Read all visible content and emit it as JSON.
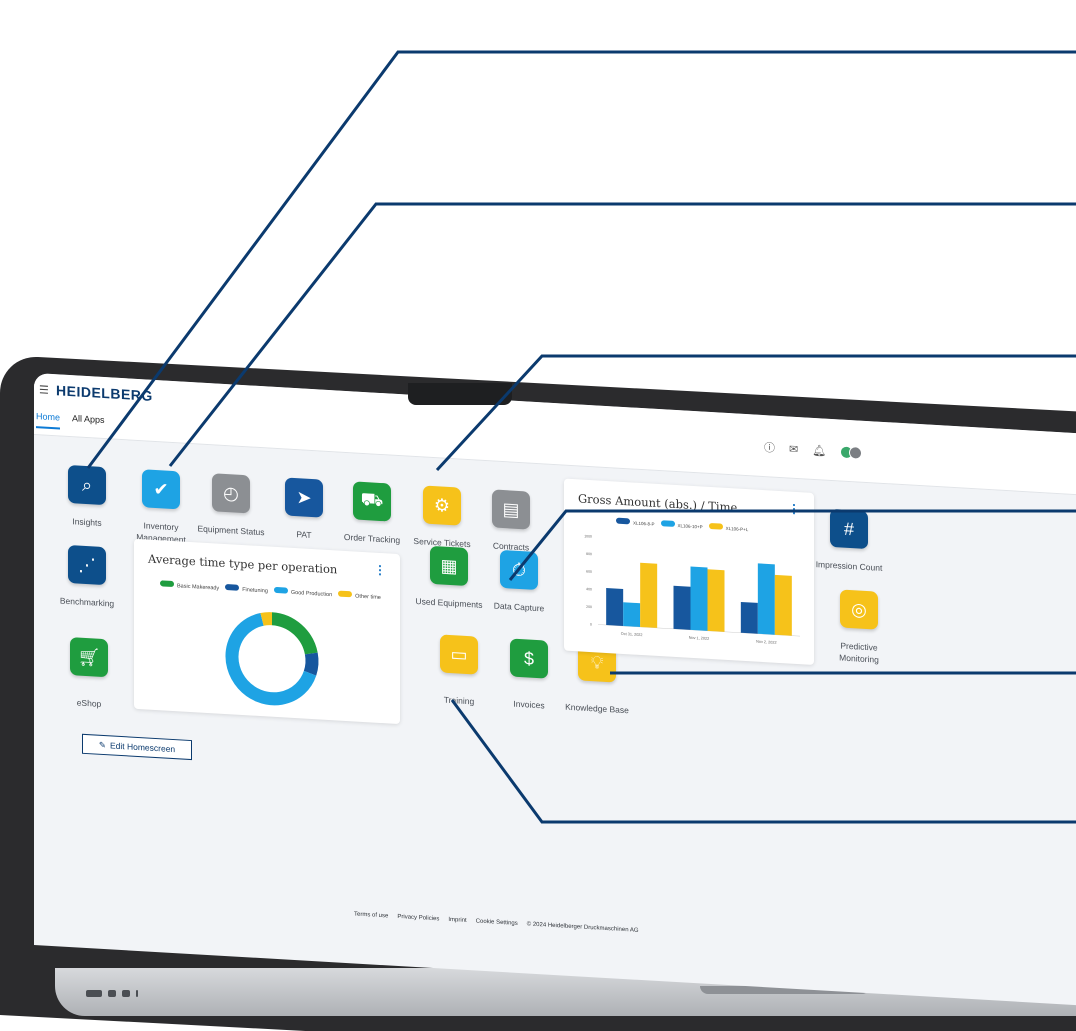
{
  "header": {
    "menu_icon": "hamburger-icon",
    "logo": "HEIDELBERG",
    "tabs": [
      {
        "label": "Home",
        "active": true
      },
      {
        "label": "All Apps",
        "active": false
      }
    ],
    "icons": [
      "info-icon",
      "mail-icon",
      "notification-icon"
    ]
  },
  "apps": {
    "insights": {
      "label": "Insights",
      "color": "#0d4f8b"
    },
    "inventory": {
      "label": "Inventory Management",
      "color": "#1ea3e4"
    },
    "equipment": {
      "label": "Equipment Status",
      "color": "#8c8f93"
    },
    "pat": {
      "label": "PAT",
      "color": "#17579e"
    },
    "order": {
      "label": "Order Tracking",
      "color": "#1f9d3f"
    },
    "service": {
      "label": "Service Tickets",
      "color": "#f6c21a"
    },
    "contracts": {
      "label": "Contracts",
      "color": "#8c8f93"
    },
    "impression": {
      "label": "Impression Count",
      "color": "#0d4f8b"
    },
    "benchmarking": {
      "label": "Benchmarking",
      "color": "#0d4f8b"
    },
    "used": {
      "label": "Used Equipments",
      "color": "#1f9d3f"
    },
    "datacapture": {
      "label": "Data Capture",
      "color": "#1ea3e4"
    },
    "predictive": {
      "label": "Predictive Monitoring",
      "color": "#f6c21a"
    },
    "eshop": {
      "label": "eShop",
      "color": "#1f9d3f"
    },
    "training": {
      "label": "Training",
      "color": "#f6c21a"
    },
    "invoices": {
      "label": "Invoices",
      "color": "#1f9d3f"
    },
    "knowledge": {
      "label": "Knowledge Base",
      "color": "#f6c21a"
    }
  },
  "donut_card": {
    "title": "Average time type per operation",
    "legend": [
      {
        "label": "Basic Makeready",
        "color": "#1f9d3f"
      },
      {
        "label": "Finetuning",
        "color": "#17579e"
      },
      {
        "label": "Good Production",
        "color": "#1ea3e4"
      },
      {
        "label": "Other time",
        "color": "#f6c21a"
      }
    ]
  },
  "bar_card": {
    "title": "Gross Amount (abs.) / Time",
    "legend": [
      {
        "label": "XL106-8-P",
        "color": "#17579e"
      },
      {
        "label": "XL106-10+P",
        "color": "#1ea3e4"
      },
      {
        "label": "XL106-P+L",
        "color": "#f6c21a"
      }
    ]
  },
  "chart_data": [
    {
      "type": "pie",
      "title": "Average time type per operation",
      "categories": [
        "Basic Makeready",
        "Finetuning",
        "Good Production",
        "Other time"
      ],
      "values": [
        22,
        8,
        66,
        4
      ],
      "colors": [
        "#1f9d3f",
        "#17579e",
        "#1ea3e4",
        "#f6c21a"
      ],
      "legend": "top"
    },
    {
      "type": "bar",
      "title": "Gross Amount (abs.) / Time",
      "categories": [
        "Oct 31, 2022",
        "Nov 1, 2022",
        "Nov 2, 2022"
      ],
      "series": [
        {
          "name": "XL106-8-P",
          "values": [
            420,
            490,
            350
          ],
          "color": "#17579e"
        },
        {
          "name": "XL106-10+P",
          "values": [
            270,
            720,
            800
          ],
          "color": "#1ea3e4"
        },
        {
          "name": "XL106-P+L",
          "values": [
            730,
            700,
            680
          ],
          "color": "#f6c21a"
        }
      ],
      "yticks": [
        "1000",
        "800",
        "600",
        "400",
        "200",
        "0"
      ],
      "ylim": [
        0,
        1000
      ],
      "legend": "top"
    }
  ],
  "edit_button": {
    "label": "Edit Homescreen",
    "icon": "pencil-icon"
  },
  "footer": {
    "links": [
      "Terms of use",
      "Privacy Policies",
      "Imprint",
      "Cookie Settings"
    ],
    "copyright": "© 2024 Heidelberger Druckmaschinen AG"
  }
}
